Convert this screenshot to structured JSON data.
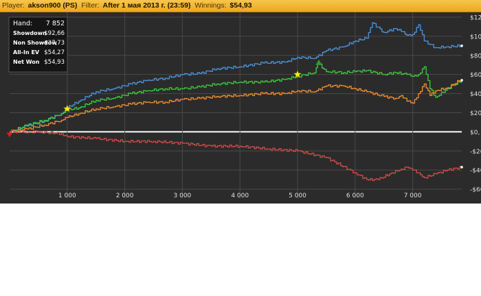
{
  "header": {
    "player_label": "Player:",
    "player": "akson900 (PS)",
    "filter_label": "Filter:",
    "filter": "After 1 мая 2013 г. (23:59)",
    "winnings_label": "Winnings:",
    "winnings": "$54,93"
  },
  "stats_box": [
    {
      "label": "Hand:",
      "value": "7 852"
    },
    {
      "label": "Showdown",
      "value": "$92,66"
    },
    {
      "label": "Non Showdow",
      "value": "-$37,73"
    },
    {
      "label": "All-In EV",
      "value": "$54,27"
    },
    {
      "label": "Net Won",
      "value": "$54,93"
    }
  ],
  "colors": {
    "background": "#2b2b2b",
    "grid": "#4a4a4a",
    "zero_line": "#ffffff",
    "showdown": "#4a8fd4",
    "net_won": "#3cc43c",
    "all_in_ev": "#e88a30",
    "non_showdown": "#d04848",
    "marker_star": "#ffee00"
  },
  "chart_data": {
    "type": "line",
    "xlim": [
      0,
      7852
    ],
    "ylim": [
      -70,
      125
    ],
    "x_ticks": [
      1000,
      2000,
      3000,
      4000,
      5000,
      6000,
      7000
    ],
    "x_tick_labels": [
      "1 000",
      "2 000",
      "3 000",
      "4 000",
      "5 000",
      "6 000",
      "7 000"
    ],
    "y_ticks": [
      120,
      100,
      80,
      60,
      40,
      20,
      0,
      -20,
      -40,
      -60
    ],
    "y_tick_labels": [
      "$12",
      "$10",
      "$80",
      "$60",
      "$40",
      "$20",
      "$0,",
      "-$20",
      "-$40",
      "-$60"
    ],
    "grid": true,
    "series": [
      {
        "key": "showdown",
        "color": "#4a8fd4",
        "x": [
          0,
          300,
          600,
          900,
          1000,
          1200,
          1500,
          1800,
          2100,
          2400,
          2700,
          3000,
          3300,
          3600,
          4000,
          4400,
          4800,
          5000,
          5300,
          5500,
          5800,
          6000,
          6200,
          6300,
          6500,
          6700,
          6800,
          6900,
          7000,
          7100,
          7200,
          7400,
          7600,
          7852
        ],
        "y": [
          0,
          6,
          11,
          19,
          25,
          32,
          42,
          45,
          50,
          54,
          56,
          60,
          61,
          66,
          68,
          72,
          73,
          78,
          77,
          85,
          89,
          95,
          98,
          114,
          104,
          108,
          105,
          101,
          102,
          112,
          95,
          88,
          89,
          90
        ]
      },
      {
        "key": "net_won",
        "color": "#3cc43c",
        "x": [
          0,
          300,
          600,
          900,
          1000,
          1200,
          1500,
          1800,
          2100,
          2400,
          2700,
          3000,
          3300,
          3600,
          4000,
          4400,
          4800,
          5000,
          5300,
          5350,
          5500,
          5800,
          6000,
          6200,
          6500,
          6700,
          6900,
          7000,
          7100,
          7200,
          7300,
          7400,
          7600,
          7852
        ],
        "y": [
          0,
          7,
          12,
          19,
          23,
          25,
          33,
          35,
          40,
          43,
          45,
          45,
          47,
          50,
          52,
          52,
          55,
          58,
          62,
          72,
          63,
          62,
          63,
          64,
          60,
          62,
          60,
          58,
          60,
          68,
          45,
          36,
          45,
          54
        ]
      },
      {
        "key": "all_in_ev",
        "color": "#e88a30",
        "x": [
          0,
          300,
          600,
          900,
          1000,
          1200,
          1500,
          1800,
          2100,
          2400,
          2700,
          3000,
          3300,
          3600,
          4000,
          4400,
          4800,
          5000,
          5300,
          5500,
          5800,
          6000,
          6200,
          6500,
          6700,
          6800,
          6900,
          7000,
          7100,
          7200,
          7300,
          7400,
          7600,
          7852
        ],
        "y": [
          0,
          3,
          7,
          12,
          15,
          19,
          24,
          26,
          29,
          31,
          31,
          34,
          35,
          37,
          38,
          40,
          40,
          43,
          42,
          48,
          48,
          45,
          42,
          37,
          35,
          38,
          32,
          30,
          40,
          50,
          38,
          43,
          46,
          55
        ]
      },
      {
        "key": "non_showdown",
        "color": "#d04848",
        "x": [
          0,
          500,
          900,
          1000,
          1500,
          2000,
          2500,
          3000,
          3500,
          4000,
          4500,
          5000,
          5500,
          6000,
          6200,
          6400,
          6600,
          6800,
          6900,
          7000,
          7100,
          7200,
          7400,
          7600,
          7852
        ],
        "y": [
          0,
          0,
          -2,
          -5,
          -7,
          -10,
          -10,
          -12,
          -15,
          -15,
          -18,
          -20,
          -27,
          -43,
          -50,
          -50,
          -44,
          -39,
          -37,
          -40,
          -43,
          -48,
          -44,
          -40,
          -37
        ]
      }
    ],
    "markers": [
      {
        "shape": "star",
        "x": 1000,
        "y": 24,
        "color": "#ffee00"
      },
      {
        "shape": "star",
        "x": 5000,
        "y": 60,
        "color": "#ffee00"
      },
      {
        "shape": "triangle-up",
        "x": 5370,
        "y": 72,
        "color": "#2e9e2e"
      },
      {
        "shape": "triangle-down",
        "x": 0,
        "y": -3,
        "color": "#d02020"
      }
    ],
    "endpoints": [
      {
        "x": 7852,
        "y": 90
      },
      {
        "x": 7852,
        "y": 54
      },
      {
        "x": 7852,
        "y": -37
      }
    ]
  }
}
